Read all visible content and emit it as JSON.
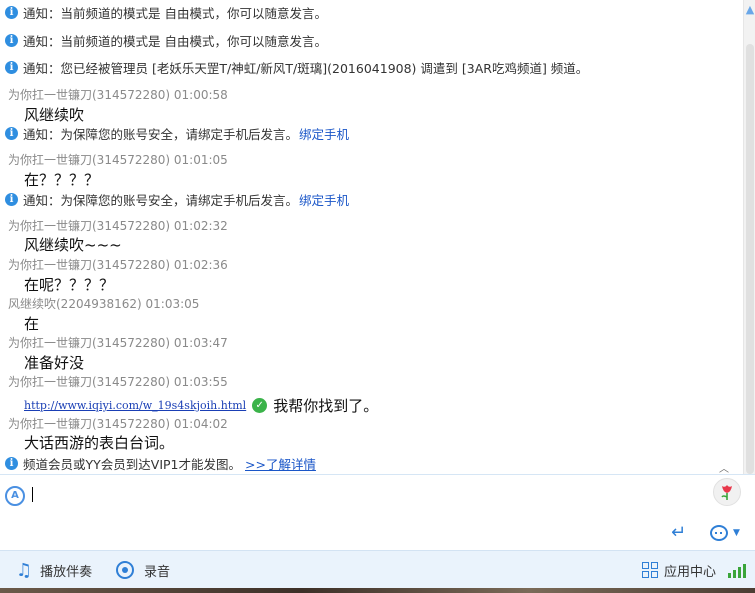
{
  "chat": {
    "notices": [
      {
        "prefix": "通知：",
        "text": "当前频道的模式是 自由模式，你可以随意发言。"
      },
      {
        "prefix": "通知：",
        "text": "当前频道的模式是 自由模式，你可以随意发言。"
      },
      {
        "prefix": "通知：",
        "text": "您已经被管理员 [老妖乐天罡T/神虹/新风T/斑璃](2016041908) 调遣到 [3AR吃鸡频道] 频道。"
      },
      {
        "prefix": "通知：",
        "text": "为保障您的账号安全，请绑定手机后发言。",
        "link": "绑定手机"
      },
      {
        "prefix": "通知：",
        "text": "为保障您的账号安全，请绑定手机后发言。",
        "link": "绑定手机"
      },
      {
        "text": "频道会员或YY会员到达VIP1才能发图。",
        "link": ">>了解详情"
      }
    ],
    "messages": [
      {
        "meta": "为你扛一世镰刀(314572280) 01:00:58",
        "text": "风继续吹"
      },
      {
        "meta": "为你扛一世镰刀(314572280) 01:01:05",
        "text": "在？？？？"
      },
      {
        "meta": "为你扛一世镰刀(314572280) 01:02:32",
        "text": "风继续吹~~~"
      },
      {
        "meta": "为你扛一世镰刀(314572280) 01:02:36",
        "text": "在呢？？？？"
      },
      {
        "meta": "风继续吹(2204938162) 01:03:05",
        "text": "在"
      },
      {
        "meta": "为你扛一世镰刀(314572280) 01:03:47",
        "text": "准备好没"
      },
      {
        "meta": "为你扛一世镰刀(314572280) 01:03:55",
        "url": "http://www.iqiyi.com/w_19s4skjoih.html",
        "text": "我帮你找到了。"
      },
      {
        "meta": "为你扛一世镰刀(314572280) 01:04:02",
        "text": "大话西游的表白台词。"
      }
    ]
  },
  "input": {
    "value": "",
    "placeholder": ""
  },
  "toolbar": {
    "play_accompaniment": "播放伴奏",
    "record": "录音",
    "app_center": "应用中心"
  },
  "icons": {
    "info": "info-icon",
    "check": "check-icon",
    "flower": "flower-icon",
    "send": "send-icon",
    "emoji": "emoji-icon",
    "music": "music-note-icon",
    "record": "record-icon",
    "apps": "app-grid-icon",
    "signal": "signal-icon"
  },
  "colors": {
    "accent": "#2f7fd6",
    "link": "#1a56c8",
    "toolbar_bg": "#eaf3fc",
    "check": "#3bb34a"
  }
}
